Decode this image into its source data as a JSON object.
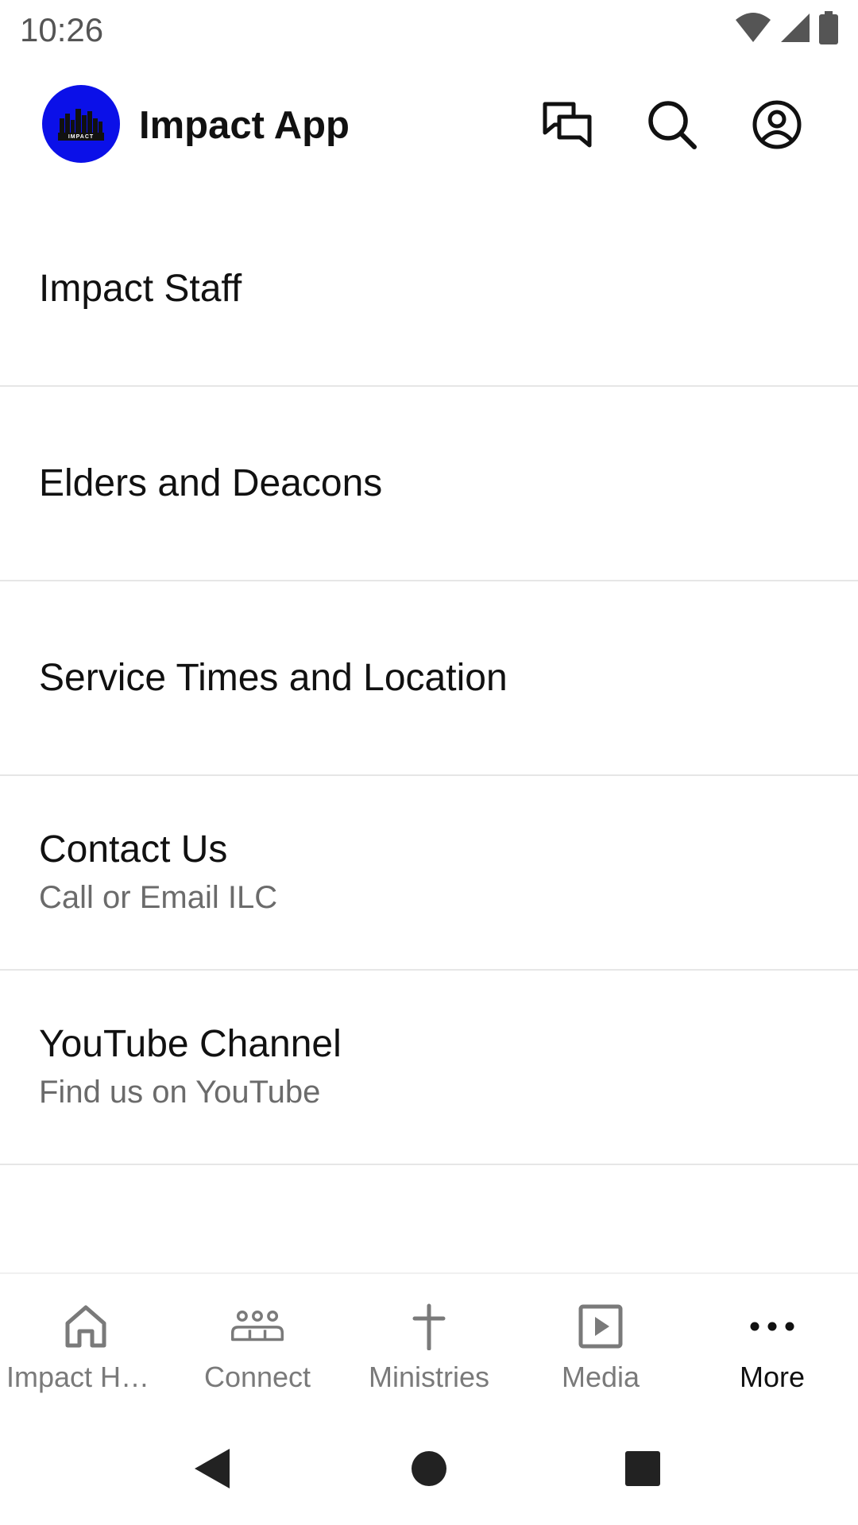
{
  "status_bar": {
    "time": "10:26"
  },
  "app_bar": {
    "title": "Impact App",
    "logo_text": "IMPACT",
    "logo_color": "#0b10e8"
  },
  "list": {
    "items": [
      {
        "title": "Impact Staff",
        "subtitle": ""
      },
      {
        "title": "Elders and Deacons",
        "subtitle": ""
      },
      {
        "title": "Service Times and Location",
        "subtitle": ""
      },
      {
        "title": "Contact Us",
        "subtitle": "Call or Email ILC"
      },
      {
        "title": "YouTube Channel",
        "subtitle": "Find us on YouTube"
      }
    ]
  },
  "bottom_nav": {
    "items": [
      {
        "label": "Impact Home",
        "icon": "home-icon",
        "active": false
      },
      {
        "label": "Connect",
        "icon": "group-icon",
        "active": false
      },
      {
        "label": "Ministries",
        "icon": "cross-icon",
        "active": false
      },
      {
        "label": "Media",
        "icon": "play-icon",
        "active": false
      },
      {
        "label": "More",
        "icon": "more-icon",
        "active": true
      }
    ]
  },
  "colors": {
    "text_primary": "#111111",
    "text_secondary": "#6b6b6b",
    "nav_inactive": "#7a7a7a",
    "divider": "#e6e6e6"
  }
}
